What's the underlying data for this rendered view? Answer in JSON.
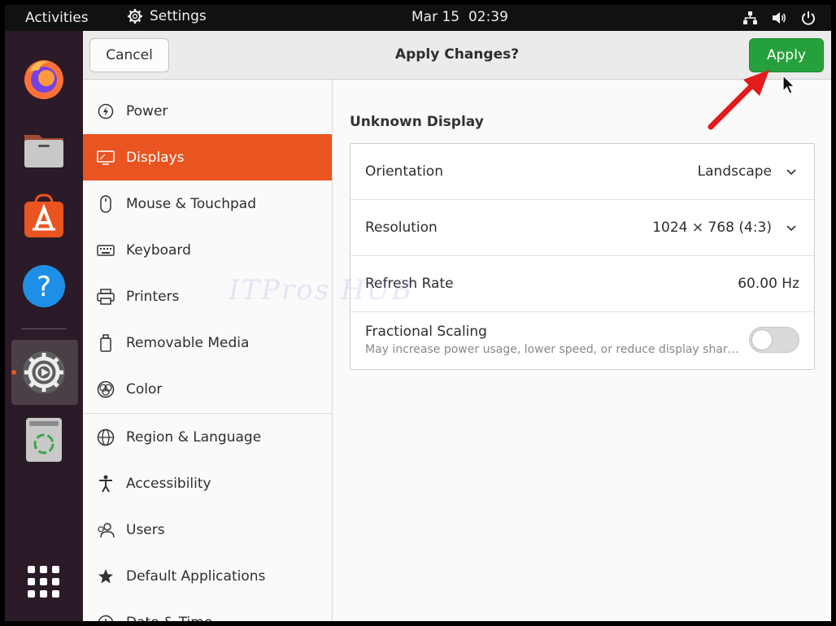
{
  "topbar": {
    "activities": "Activities",
    "app_name": "Settings",
    "date": "Mar 15",
    "time": "02:39",
    "icons": [
      "network-icon",
      "volume-icon",
      "power-icon"
    ]
  },
  "dock": {
    "items": [
      "firefox-icon",
      "files-icon",
      "software-icon",
      "help-icon",
      "settings-icon",
      "trash-icon",
      "show-apps-icon"
    ],
    "running_indicator_color": "#e95420"
  },
  "header": {
    "cancel_label": "Cancel",
    "title": "Apply Changes?",
    "apply_label": "Apply",
    "apply_color": "#26a03a"
  },
  "sidebar": {
    "accent": "#e95420",
    "items": [
      {
        "label": "Power",
        "icon": "power-icon"
      },
      {
        "label": "Displays",
        "icon": "display-icon",
        "active": true
      },
      {
        "label": "Mouse & Touchpad",
        "icon": "mouse-icon"
      },
      {
        "label": "Keyboard",
        "icon": "keyboard-icon"
      },
      {
        "label": "Printers",
        "icon": "printer-icon"
      },
      {
        "label": "Removable Media",
        "icon": "media-icon"
      },
      {
        "label": "Color",
        "icon": "color-icon"
      },
      {
        "label": "Region & Language",
        "icon": "globe-icon"
      },
      {
        "label": "Accessibility",
        "icon": "accessibility-icon"
      },
      {
        "label": "Users",
        "icon": "users-icon"
      },
      {
        "label": "Default Applications",
        "icon": "star-icon"
      },
      {
        "label": "Date & Time",
        "icon": "clock-icon"
      }
    ]
  },
  "display": {
    "title": "Unknown Display",
    "orientation": {
      "label": "Orientation",
      "value": "Landscape"
    },
    "resolution": {
      "label": "Resolution",
      "value": "1024 × 768 (4:3)"
    },
    "refresh_rate": {
      "label": "Refresh Rate",
      "value": "60.00 Hz"
    },
    "fractional_scaling": {
      "label": "Fractional Scaling",
      "description": "May increase power usage, lower speed, or reduce display sharpness.",
      "enabled": false
    }
  },
  "watermark": "ITPros HUB"
}
